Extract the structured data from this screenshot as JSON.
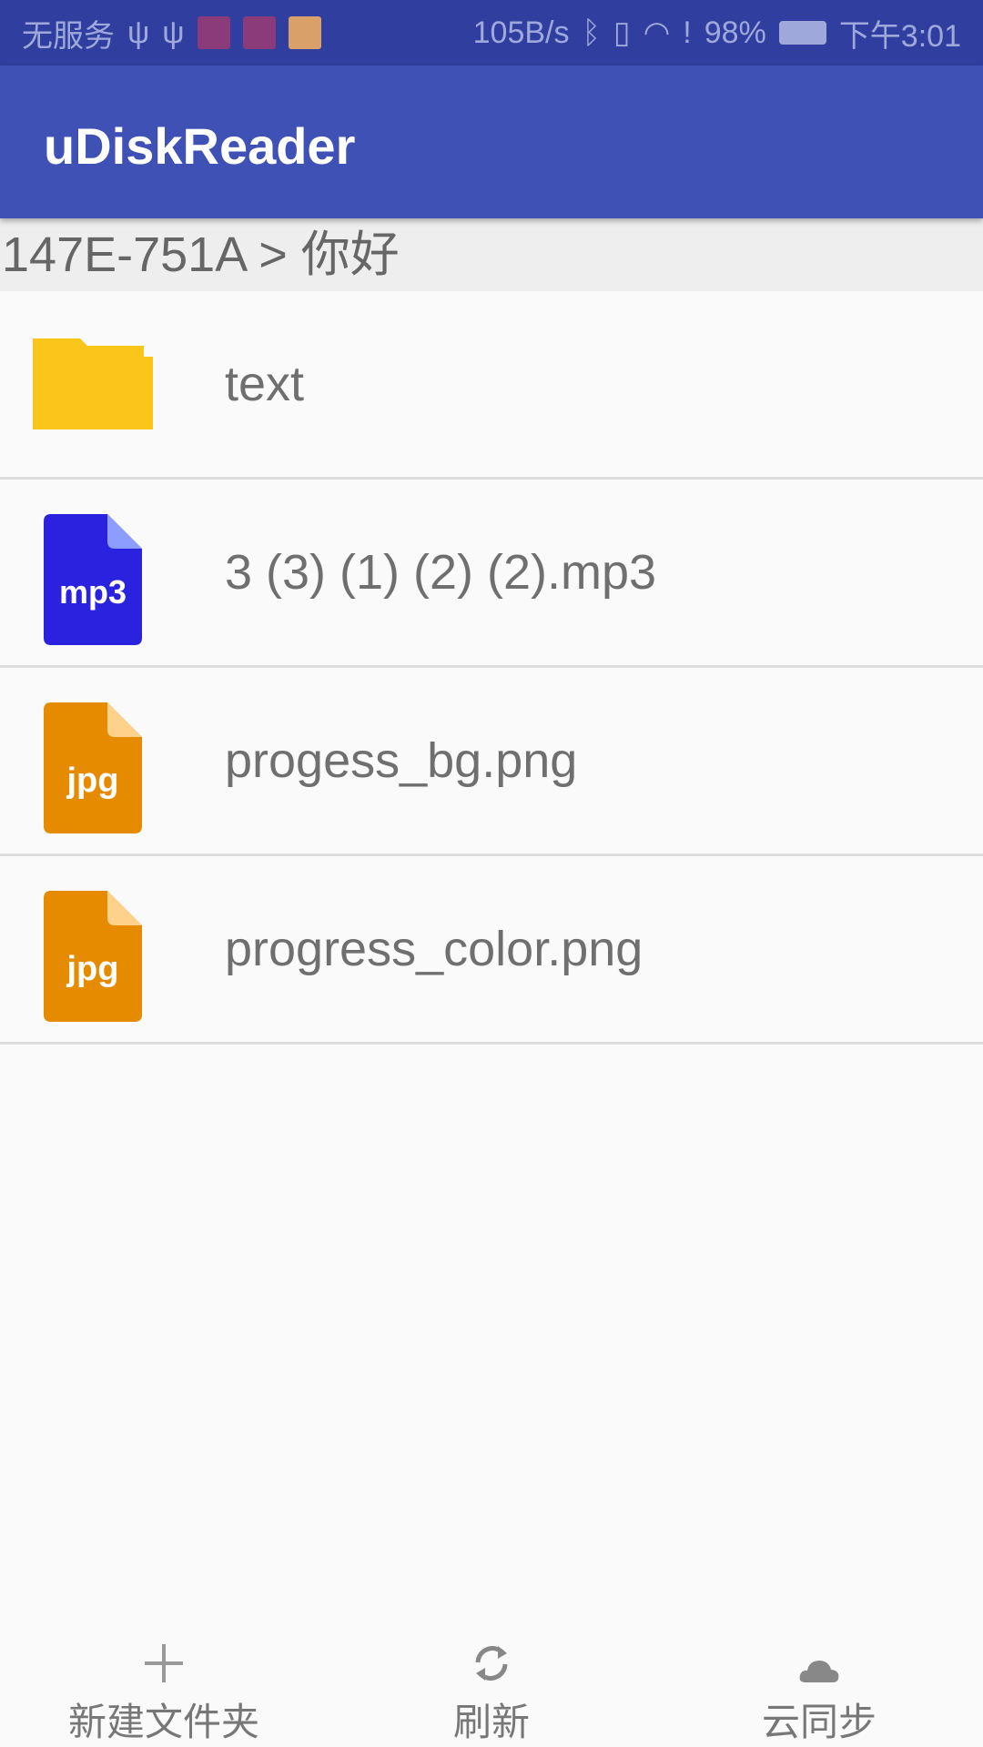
{
  "status_bar": {
    "carrier": "无服务",
    "net_speed": "105B/s",
    "battery": "98%",
    "time": "下午3:01"
  },
  "app_bar": {
    "title": "uDiskReader"
  },
  "breadcrumb": {
    "path": "147E-751A > 你好"
  },
  "files": [
    {
      "name": "text",
      "type": "folder"
    },
    {
      "name": "3 (3) (1) (2) (2).mp3",
      "type": "mp3",
      "badge": "mp3",
      "color": "#2b22e0"
    },
    {
      "name": "progess_bg.png",
      "type": "jpg",
      "badge": "jpg",
      "color": "#e68a00"
    },
    {
      "name": "progress_color.png",
      "type": "jpg",
      "badge": "jpg",
      "color": "#e68a00"
    }
  ],
  "bottom_bar": {
    "new_folder": "新建文件夹",
    "refresh": "刷新",
    "cloud_sync": "云同步"
  },
  "colors": {
    "primary": "#3f51b5",
    "primary_dark": "#303f9f",
    "folder": "#fbc61c"
  }
}
